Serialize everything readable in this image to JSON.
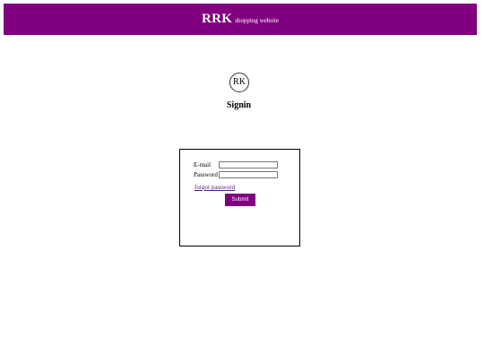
{
  "header": {
    "brand": "RRK",
    "tagline": "shopping website"
  },
  "logo": {
    "text": "RK"
  },
  "page": {
    "title": "Signin"
  },
  "form": {
    "email_label": "E-mail",
    "email_value": "",
    "password_label": "Password",
    "password_value": "",
    "forgot_label": "forgot password",
    "submit_label": "Submit"
  },
  "colors": {
    "accent": "#800080"
  }
}
